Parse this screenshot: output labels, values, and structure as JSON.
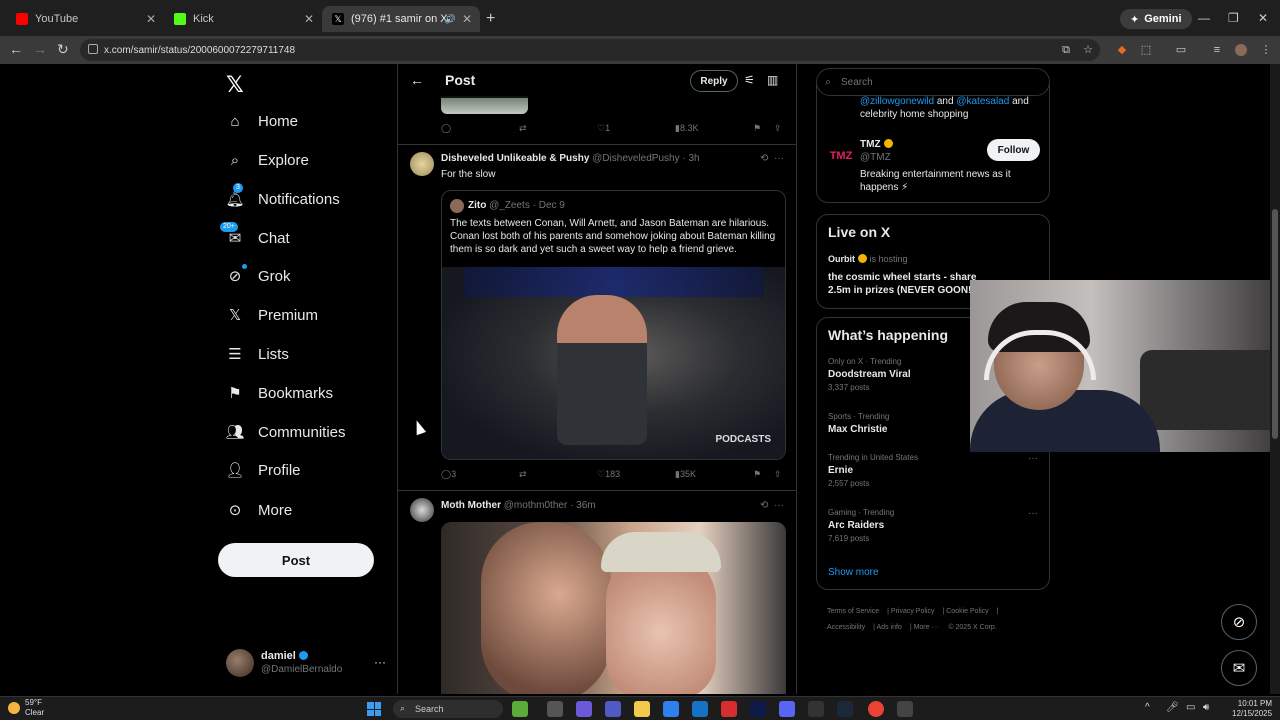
{
  "browser": {
    "tabs": [
      {
        "label": "YouTube",
        "color": "#ff0000"
      },
      {
        "label": "Kick",
        "color": "#53fc18"
      },
      {
        "label": "(976) #1 samir on X: \"happ",
        "color": "#ffffff"
      }
    ],
    "gemini_label": "Gemini",
    "url": "x.com/samir/status/2000600072279711748"
  },
  "nav": {
    "items": [
      {
        "label": "Home",
        "icon": "home-icon"
      },
      {
        "label": "Explore",
        "icon": "search-icon"
      },
      {
        "label": "Notifications",
        "icon": "bell-icon",
        "badge": "3"
      },
      {
        "label": "Chat",
        "icon": "mail-icon",
        "badge": "20+"
      },
      {
        "label": "Grok",
        "icon": "grok-icon"
      },
      {
        "label": "Premium",
        "icon": "x-icon"
      },
      {
        "label": "Lists",
        "icon": "list-icon"
      },
      {
        "label": "Bookmarks",
        "icon": "bookmark-icon"
      },
      {
        "label": "Communities",
        "icon": "people-icon"
      },
      {
        "label": "Profile",
        "icon": "person-icon"
      },
      {
        "label": "More",
        "icon": "more-circle-icon"
      }
    ],
    "post_label": "Post",
    "account": {
      "name": "damiel",
      "handle": "@DamielBernaldo"
    }
  },
  "header": {
    "title": "Post",
    "reply_label": "Reply"
  },
  "prev_actions": {
    "replies": "",
    "reposts": "",
    "likes": "1",
    "views": "8.3K"
  },
  "tweet1": {
    "name": "Disheveled Unlikeable & Pushy",
    "handle": "@DisheveledPushy · 3h",
    "text": "For the slow",
    "quote": {
      "name": "Zito",
      "handle": "@_Zeets · Dec 9",
      "text": "The texts between Conan, Will Arnett, and Jason Bateman are hilarious. Conan lost both of his parents and somehow joking about Bateman killing them is so dark and yet such a sweet way to help a friend grieve.",
      "watermark": "PODCASTS"
    },
    "actions": {
      "replies": "3",
      "reposts": "",
      "likes": "183",
      "views": "35K"
    }
  },
  "tweet2": {
    "name": "Moth Mother",
    "handle": "@mothm0ther · 36m"
  },
  "right": {
    "search_placeholder": "Search",
    "prev_bio_link1": "@zillowgonewild",
    "prev_bio_and": " and ",
    "prev_bio_link2": "@katesalad",
    "prev_bio_tail": " and celebrity home shopping",
    "tmz": {
      "name": "TMZ",
      "handle": "@TMZ",
      "bio": "Breaking entertainment news as it happens ⚡",
      "follow_label": "Follow",
      "logo": "TMZ"
    },
    "live": {
      "title": "Live on X",
      "host": "Ourbit",
      "host_suffix": " is hosting",
      "text": "the cosmic wheel starts - share 2.5m in prizes (NEVER GOON!"
    },
    "happening": {
      "title": "What’s happening",
      "trends": [
        {
          "category": "Only on X · Trending",
          "name": "Doodstream Viral",
          "count": "3,337 posts"
        },
        {
          "category": "Sports · Trending",
          "name": "Max Christie",
          "count": ""
        },
        {
          "category": "Trending in United States",
          "name": "Ernie",
          "count": "2,557 posts"
        },
        {
          "category": "Gaming · Trending",
          "name": "Arc Raiders",
          "count": "7,619 posts"
        }
      ],
      "show_more": "Show more"
    },
    "footer": [
      "Terms of Service",
      "Privacy Policy",
      "Cookie Policy",
      "Accessibility",
      "Ads info",
      "More ···",
      "© 2025 X Corp."
    ]
  },
  "taskbar": {
    "temp": "59°F",
    "condition": "Clear",
    "search_label": "Search",
    "time": "10:01 PM",
    "date": "12/15/2025"
  }
}
